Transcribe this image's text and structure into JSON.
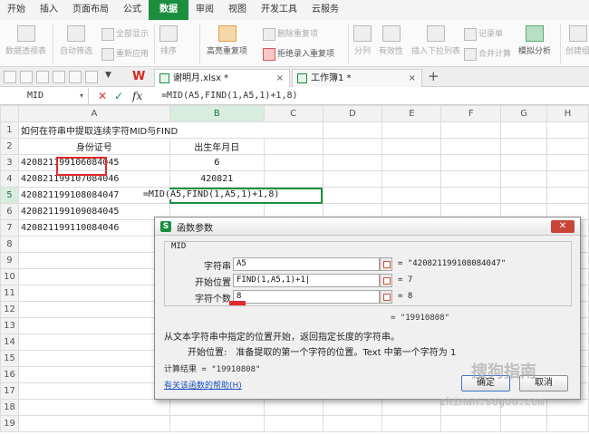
{
  "menu": {
    "tabs": [
      "开始",
      "插入",
      "页面布局",
      "公式",
      "数据",
      "审阅",
      "视图",
      "开发工具",
      "云服务"
    ],
    "active_index": 4
  },
  "ribbon": {
    "pivot_table": "数据透视表",
    "auto_filter": "自动筛选",
    "show_all": "全部显示",
    "reapply": "重新应用",
    "sort": "排序",
    "highlight_dup": "高亮重复项",
    "delete_dup": "删除重复项",
    "reject_dup": "拒绝录入重复项",
    "split": "分列",
    "validity": "有效性",
    "insert_dropdown": "插入下拉列表",
    "merge_calc": "合并计算",
    "record_sheet": "记录单",
    "simulate": "模拟分析",
    "create_group": "创建组"
  },
  "doc_tabs": [
    {
      "label": "谢明月.xlsx *",
      "active": true
    },
    {
      "label": "工作簿1 *",
      "active": false
    }
  ],
  "formula_bar": {
    "name_box": "MID",
    "formula": "=MID(A5,FIND(1,A5,1)+1,8)"
  },
  "sheet": {
    "columns": [
      "A",
      "B",
      "C",
      "D",
      "E",
      "F",
      "G",
      "H"
    ],
    "rows": [
      "1",
      "2",
      "3",
      "4",
      "5",
      "6",
      "7",
      "8",
      "9",
      "10",
      "11",
      "12",
      "13",
      "14",
      "15",
      "16",
      "17",
      "18",
      "19"
    ],
    "title": "如何在符串中提取连续字符MID与FIND",
    "header_a": "身份证号",
    "header_b": "出生年月日",
    "a3": "420821199106084045",
    "a4": "420821199107084046",
    "a5": "420821199108084047",
    "a6": "420821199109084045",
    "a7": "420821199110084046",
    "b3": "6",
    "b4": "420821",
    "b5": "=MID(A5,FIND(1,A5,1)+1,8)"
  },
  "dialog": {
    "title": "函数参数",
    "close": "✕",
    "group": "MID",
    "args": [
      {
        "label": "字符串",
        "value": "A5",
        "result": "= \"420821199108084047\""
      },
      {
        "label": "开始位置",
        "value": "FIND(1,A5,1)+1|",
        "result": "= 7"
      },
      {
        "label": "字符个数",
        "value": "8",
        "result": "= 8"
      }
    ],
    "result_preview": "= \"19910808\"",
    "description": "从文本字符串中指定的位置开始，返回指定长度的字符串。",
    "arg_desc_name": "开始位置:",
    "arg_desc_text": "准备提取的第一个字符的位置。Text 中第一个字符为 1",
    "calc_result": "计算结果 = \"19910808\"",
    "help_link": "有关该函数的帮助(H)",
    "ok": "确定",
    "cancel": "取消"
  },
  "watermark": {
    "text": "搜狗指南",
    "url": "zhinan.sogou.com"
  },
  "colors": {
    "accent": "#1b8f3e",
    "highlight": "#e12a2a"
  }
}
